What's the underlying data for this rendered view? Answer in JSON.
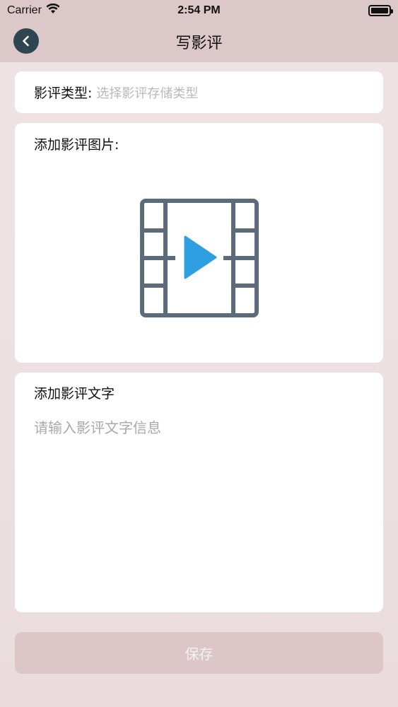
{
  "status_bar": {
    "carrier": "Carrier",
    "time": "2:54 PM",
    "battery_level": 1.0
  },
  "nav": {
    "title": "写影评",
    "back_icon": "chevron-left-icon"
  },
  "type_section": {
    "label": "影评类型:",
    "placeholder": "选择影评存储类型"
  },
  "image_section": {
    "label": "添加影评图片:",
    "icon": "video-film-icon",
    "icon_frame_color": "#5b6b7a",
    "icon_play_color": "#2e9fe0"
  },
  "text_section": {
    "label": "添加影评文字",
    "placeholder": "请输入影评文字信息"
  },
  "save_button": {
    "label": "保存"
  },
  "colors": {
    "header_bg": "#dcc8c9",
    "back_button_bg": "#2f4650",
    "save_button_bg": "#dcc6c8"
  }
}
